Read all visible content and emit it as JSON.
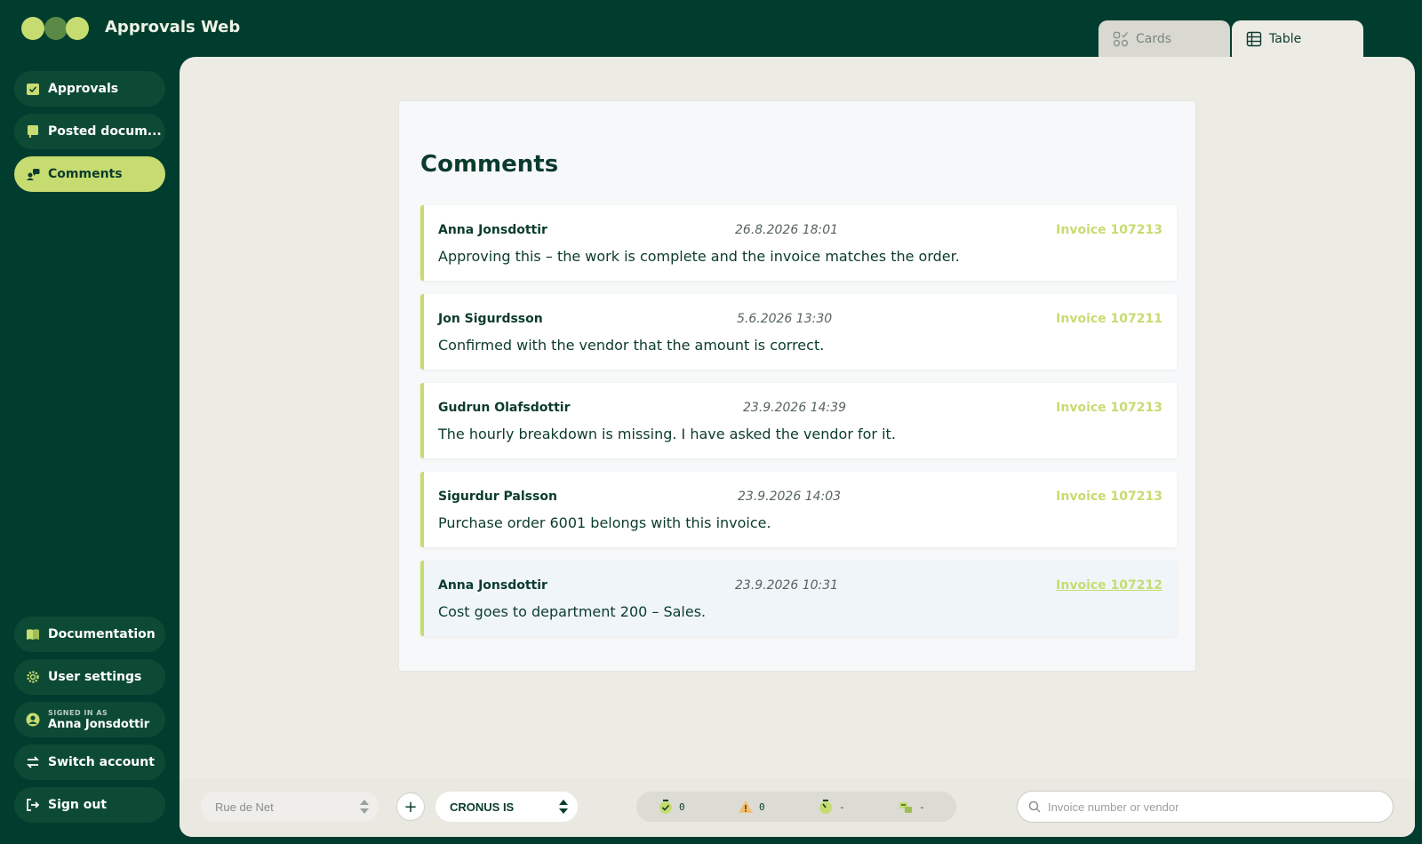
{
  "header": {
    "app_title": "Approvals Web",
    "view_tabs": [
      {
        "label": "Cards",
        "icon": "cards-icon",
        "active": false
      },
      {
        "label": "Table",
        "icon": "table-icon",
        "active": true
      }
    ]
  },
  "sidebar": {
    "items": [
      {
        "label": "Approvals",
        "icon": "approvals-icon",
        "active": false
      },
      {
        "label": "Posted docum...",
        "icon": "document-icon",
        "active": false
      },
      {
        "label": "Comments",
        "icon": "comments-icon",
        "active": true
      }
    ],
    "bottom": {
      "documentation": "Documentation",
      "user_settings": "User settings",
      "signed_in_label": "SIGNED IN AS",
      "signed_in_user": "Anna Jonsdottir",
      "switch_account": "Switch account",
      "sign_out": "Sign out"
    }
  },
  "main": {
    "title": "Comments",
    "comments": [
      {
        "author": "Anna Jonsdottir",
        "date": "26.8.2026 18:01",
        "invoice": "Invoice 107213",
        "text": "Approving this – the work is complete and the invoice matches the order."
      },
      {
        "author": "Jon Sigurdsson",
        "date": "5.6.2026 13:30",
        "invoice": "Invoice 107211",
        "text": "Confirmed with the vendor that the amount is correct."
      },
      {
        "author": "Gudrun Olafsdottir",
        "date": "23.9.2026 14:39",
        "invoice": "Invoice 107213",
        "text": "The hourly breakdown is missing. I have asked the vendor for it."
      },
      {
        "author": "Sigurdur Palsson",
        "date": "23.9.2026 14:03",
        "invoice": "Invoice 107213",
        "text": "Purchase order 6001 belongs with this invoice."
      },
      {
        "author": "Anna Jonsdottir",
        "date": "23.9.2026 10:31",
        "invoice": "Invoice 107212",
        "text": "Cost goes to department 200 – Sales.",
        "highlighted": true
      }
    ]
  },
  "bottom_bar": {
    "company_select": "Rue de Net",
    "add_button": "+",
    "tenant_select": "CRONUS IS",
    "stats": [
      {
        "icon": "approved-icon",
        "value": "0"
      },
      {
        "icon": "warning-icon",
        "value": "0"
      },
      {
        "icon": "pending-icon",
        "value": "-"
      },
      {
        "icon": "posted-icon",
        "value": "-"
      }
    ],
    "search_placeholder": "Invoice number or vendor"
  },
  "colors": {
    "brand_dark": "#003d2e",
    "accent": "#c7dc70",
    "panel": "#ecebe4"
  }
}
